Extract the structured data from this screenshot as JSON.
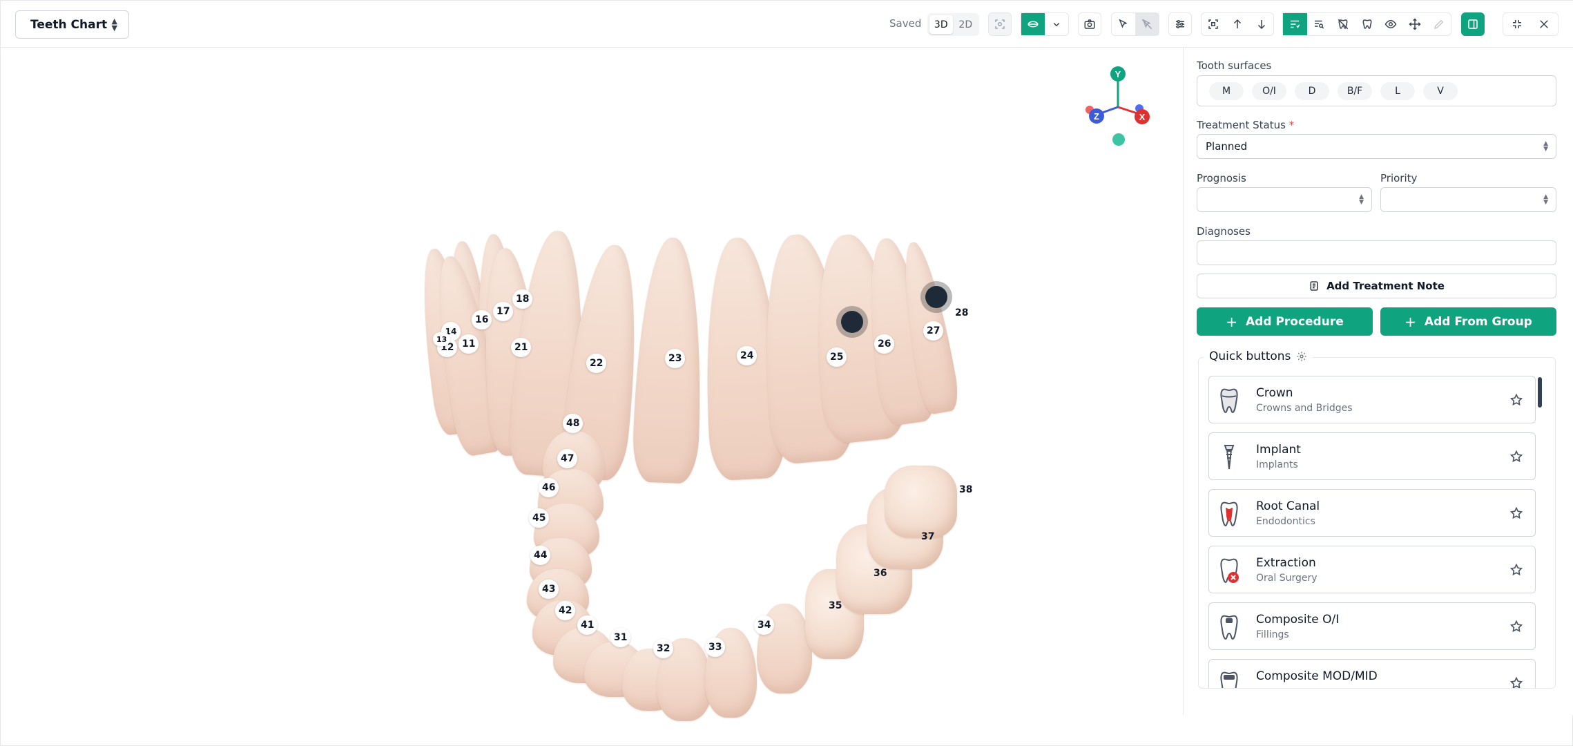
{
  "header": {
    "title": "Teeth Chart",
    "saved_label": "Saved",
    "view_modes": [
      "3D",
      "2D"
    ],
    "active_view": "3D"
  },
  "colors": {
    "accent": "#10a37f",
    "marker": "#1e2a38",
    "required": "#ef4444"
  },
  "toolbar_icons": [
    "focus-icon",
    "visibility-icon",
    "chevron-down-icon",
    "camera-icon",
    "select-icon",
    "deselect-icon",
    "sliders-icon",
    "fit-view-icon",
    "arrow-up-icon",
    "arrow-down-icon",
    "list-filter-icon",
    "search-list-icon",
    "tooth-off-icon",
    "tooth-chart-icon",
    "eye-icon",
    "move-icon",
    "pencil-icon",
    "panel-toggle-icon",
    "minimize-icon",
    "close-icon"
  ],
  "chart": {
    "tooth_labels": [
      "18",
      "17",
      "16",
      "14",
      "11",
      "12",
      "13",
      "21",
      "22",
      "23",
      "24",
      "25",
      "26",
      "27",
      "28",
      "48",
      "47",
      "46",
      "45",
      "44",
      "43",
      "42",
      "41",
      "31",
      "32",
      "33",
      "34",
      "35",
      "36",
      "37",
      "38"
    ],
    "axis_labels": [
      "Y",
      "Z",
      "X"
    ]
  },
  "panel": {
    "surfaces_label": "Tooth surfaces",
    "surfaces": [
      "M",
      "O/I",
      "D",
      "B/F",
      "L",
      "V"
    ],
    "treatment_status_label": "Treatment Status",
    "required_mark": "*",
    "treatment_status_value": "Planned",
    "prognosis_label": "Prognosis",
    "priority_label": "Priority",
    "diagnoses_label": "Diagnoses",
    "add_note_label": "Add Treatment Note",
    "add_procedure_label": "Add Procedure",
    "add_group_label": "Add From Group",
    "quick_buttons_label": "Quick buttons",
    "quick_buttons": [
      {
        "name": "Crown",
        "category": "Crowns and Bridges",
        "icon": "crown-tooth-icon"
      },
      {
        "name": "Implant",
        "category": "Implants",
        "icon": "implant-icon"
      },
      {
        "name": "Root Canal",
        "category": "Endodontics",
        "icon": "root-canal-icon"
      },
      {
        "name": "Extraction",
        "category": "Oral Surgery",
        "icon": "extraction-icon"
      },
      {
        "name": "Composite O/I",
        "category": "Fillings",
        "icon": "filling-icon"
      },
      {
        "name": "Composite MOD/MID",
        "category": "",
        "icon": "filling-icon"
      }
    ]
  }
}
